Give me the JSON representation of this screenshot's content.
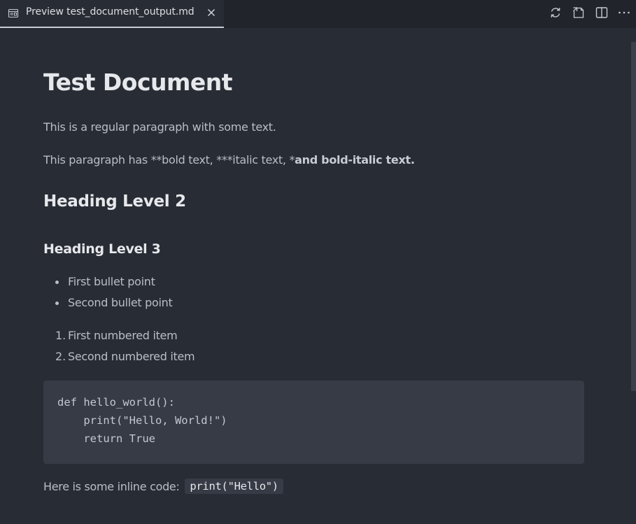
{
  "tab": {
    "title": "Preview test_document_output.md",
    "icon": "preview-icon",
    "close_icon": "close-icon"
  },
  "toolbar": {
    "icons": [
      "refresh-icon",
      "open-source-icon",
      "split-editor-icon",
      "more-actions-icon"
    ]
  },
  "document": {
    "h1": "Test Document",
    "para1": "This is a regular paragraph with some text.",
    "para2_plain": "This paragraph has **bold text, ***italic text, *",
    "para2_bold": "and bold-italic text",
    "para2_end": ".",
    "h2": "Heading Level 2",
    "h3": "Heading Level 3",
    "bullets": [
      "First bullet point",
      "Second bullet point"
    ],
    "numbered": [
      {
        "num": "1.",
        "text": "First numbered item"
      },
      {
        "num": "2.",
        "text": "Second numbered item"
      }
    ],
    "code_lines": [
      "def hello_world():",
      "    print(\"Hello, World!\")",
      "    return True"
    ],
    "inline_prefix": "Here is some inline code:",
    "inline_code": "print(\"Hello\")"
  },
  "colors": {
    "background": "#282c34",
    "tabbar": "#21252b",
    "text": "#b9bec7",
    "heading": "#e6e8eb",
    "code_bg": "#363b45"
  }
}
